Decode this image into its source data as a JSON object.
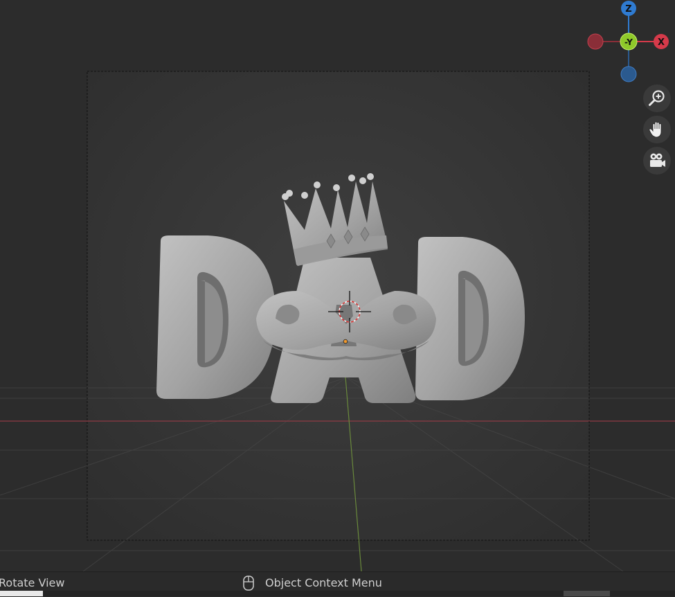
{
  "gizmo": {
    "axis_z": "Z",
    "axis_neg_y": "-Y",
    "axis_x": "X",
    "colors": {
      "z": "#2f7bd1",
      "y": "#8fc92a",
      "x": "#d63a4a",
      "neg_x": "#8a2e38",
      "neg_z": "#2b5a8f"
    }
  },
  "nav_buttons": {
    "zoom_icon": "zoom-in-icon",
    "pan_icon": "hand-icon",
    "camera_icon": "camera-icon"
  },
  "scene": {
    "object_text": "DAD",
    "background_color": "#3d3d3d",
    "object_color": "#a6a6a6"
  },
  "status_bar": {
    "left_hint": "Rotate View",
    "mouse_icon": "mouse-right-click-icon",
    "context_hint": "Object Context Menu"
  }
}
